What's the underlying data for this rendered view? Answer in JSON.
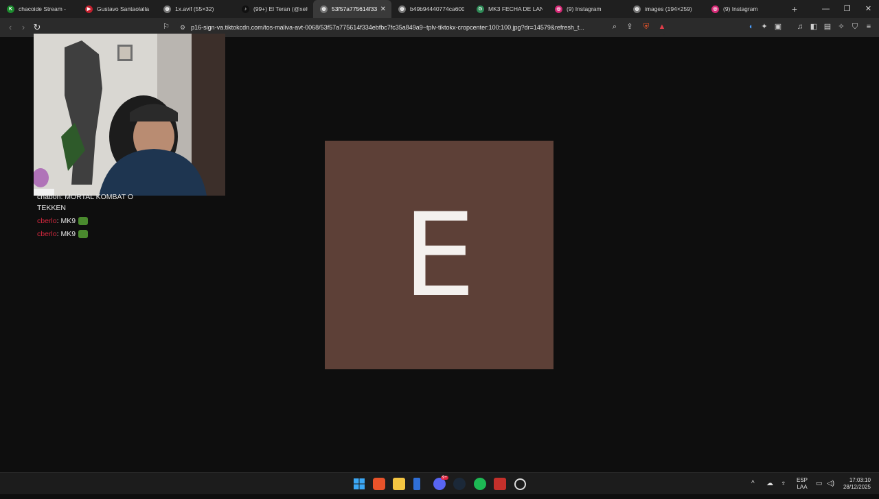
{
  "tabs": [
    {
      "title": "chacoide Stream -",
      "fav_color": "#1c8c2e",
      "fav_char": "K"
    },
    {
      "title": "Gustavo Santaolalla",
      "fav_color": "#c4202e",
      "fav_char": "▶"
    },
    {
      "title": "1x.avif (55×32)",
      "fav_color": "#777777",
      "fav_char": "◍"
    },
    {
      "title": "(99+) El Teran (@xelter",
      "fav_color": "#111111",
      "fav_char": "♪"
    },
    {
      "title": "53f57a775614f33",
      "fav_color": "#777777",
      "fav_char": "◍",
      "active": true
    },
    {
      "title": "b49b94440774ca600a",
      "fav_color": "#777777",
      "fav_char": "◍"
    },
    {
      "title": "MK3 FECHA DE LANZA",
      "fav_color": "#2e8b57",
      "fav_char": "G"
    },
    {
      "title": "(9) Instagram",
      "fav_color": "#d62976",
      "fav_char": "◎"
    },
    {
      "title": "images (194×259)",
      "fav_color": "#777777",
      "fav_char": "◍"
    },
    {
      "title": "(9) Instagram",
      "fav_color": "#d62976",
      "fav_char": "◎"
    }
  ],
  "address_bar": {
    "url": "p16-sign-va.tiktokcdn.com/tos-maliva-avt-0068/53f57a775614f334ebfbc7fc35a849a9~tplv-tiktokx-cropcenter:100:100.jpg?dr=14579&refresh_t..."
  },
  "chat": {
    "partial_line": "chabon: MORTAL KOMBAT O",
    "partial_cont": "TEKKEN",
    "messages": [
      {
        "user": "cberlo",
        "text": "MK9"
      },
      {
        "user": "cberlo",
        "text": "MK9"
      }
    ]
  },
  "image": {
    "letter": "E",
    "bg_color": "#5d4037"
  },
  "taskbar": {
    "language": "ESP",
    "layout": "LAA",
    "time": "17:03:10",
    "date": "28/12/2025",
    "discord_badge": "9+"
  }
}
